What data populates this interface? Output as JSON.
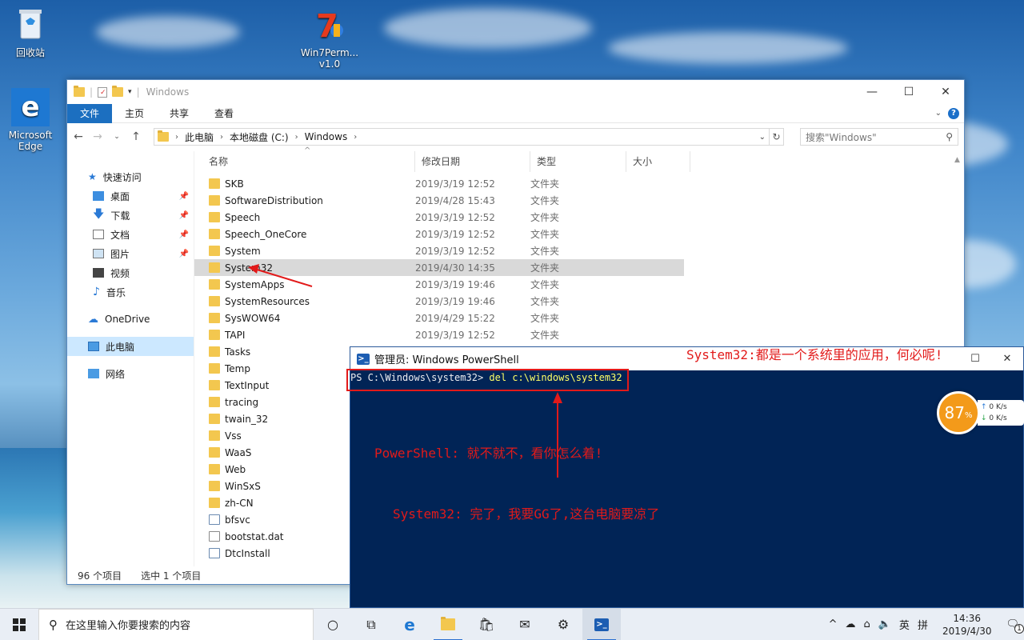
{
  "desktop": {
    "icons": [
      {
        "label": "回收站"
      },
      {
        "label": "Win7Perm...\nv1.0",
        "line1": "Win7Perm...",
        "line2": "v1.0"
      },
      {
        "label": "Microsoft Edge",
        "line1": "Microsoft",
        "line2": "Edge"
      }
    ]
  },
  "explorer": {
    "title": "Windows",
    "ribbon_tabs": [
      "文件",
      "主页",
      "共享",
      "查看"
    ],
    "help": "?",
    "address": {
      "segments": [
        "此电脑",
        "本地磁盘 (C:)",
        "Windows"
      ]
    },
    "search_placeholder": "搜索\"Windows\"",
    "nav": {
      "quick_access": "快速访问",
      "items": [
        "桌面",
        "下载",
        "文档",
        "图片",
        "视频",
        "音乐"
      ],
      "onedrive": "OneDrive",
      "this_pc": "此电脑",
      "network": "网络"
    },
    "columns": [
      "名称",
      "修改日期",
      "类型",
      "大小"
    ],
    "rows": [
      {
        "name": "SKB",
        "date": "2019/3/19 12:52",
        "type": "文件夹"
      },
      {
        "name": "SoftwareDistribution",
        "date": "2019/4/28 15:43",
        "type": "文件夹"
      },
      {
        "name": "Speech",
        "date": "2019/3/19 12:52",
        "type": "文件夹"
      },
      {
        "name": "Speech_OneCore",
        "date": "2019/3/19 12:52",
        "type": "文件夹"
      },
      {
        "name": "System",
        "date": "2019/3/19 12:52",
        "type": "文件夹"
      },
      {
        "name": "System32",
        "date": "2019/4/30 14:35",
        "type": "文件夹"
      },
      {
        "name": "SystemApps",
        "date": "2019/3/19 19:46",
        "type": "文件夹"
      },
      {
        "name": "SystemResources",
        "date": "2019/3/19 19:46",
        "type": "文件夹"
      },
      {
        "name": "SysWOW64",
        "date": "2019/4/29 15:22",
        "type": "文件夹"
      },
      {
        "name": "TAPI",
        "date": "2019/3/19 12:52",
        "type": "文件夹"
      },
      {
        "name": "Tasks",
        "date": "",
        "type": ""
      },
      {
        "name": "Temp",
        "date": "",
        "type": ""
      },
      {
        "name": "TextInput",
        "date": "",
        "type": ""
      },
      {
        "name": "tracing",
        "date": "",
        "type": ""
      },
      {
        "name": "twain_32",
        "date": "",
        "type": ""
      },
      {
        "name": "Vss",
        "date": "",
        "type": ""
      },
      {
        "name": "WaaS",
        "date": "",
        "type": ""
      },
      {
        "name": "Web",
        "date": "",
        "type": ""
      },
      {
        "name": "WinSxS",
        "date": "",
        "type": ""
      },
      {
        "name": "zh-CN",
        "date": "",
        "type": ""
      },
      {
        "name": "bfsvc",
        "date": "",
        "type": ""
      },
      {
        "name": "bootstat.dat",
        "date": "",
        "type": ""
      },
      {
        "name": "DtcInstall",
        "date": "",
        "type": ""
      }
    ],
    "status": {
      "count": "96 个项目",
      "selected": "选中 1 个项目"
    }
  },
  "powershell": {
    "title": "管理员: Windows PowerShell",
    "prompt": "PS C:\\Windows\\system32> ",
    "command": "del c:\\windows\\system32"
  },
  "annotations": {
    "top": "System32:都是一个系统里的应用，何必呢!",
    "middle": "PowerShell: 就不就不，看你怎么着!",
    "bottom": "System32: 完了，我要GG了,这台电脑要凉了"
  },
  "net_widget": {
    "percent": "87",
    "unit": "%",
    "up": "0 K/s",
    "down": "0 K/s"
  },
  "taskbar": {
    "search_placeholder": "在这里输入你要搜索的内容",
    "ime": "英",
    "ime2": "拼",
    "time": "14:36",
    "date": "2019/4/30",
    "notification_count": "1"
  }
}
